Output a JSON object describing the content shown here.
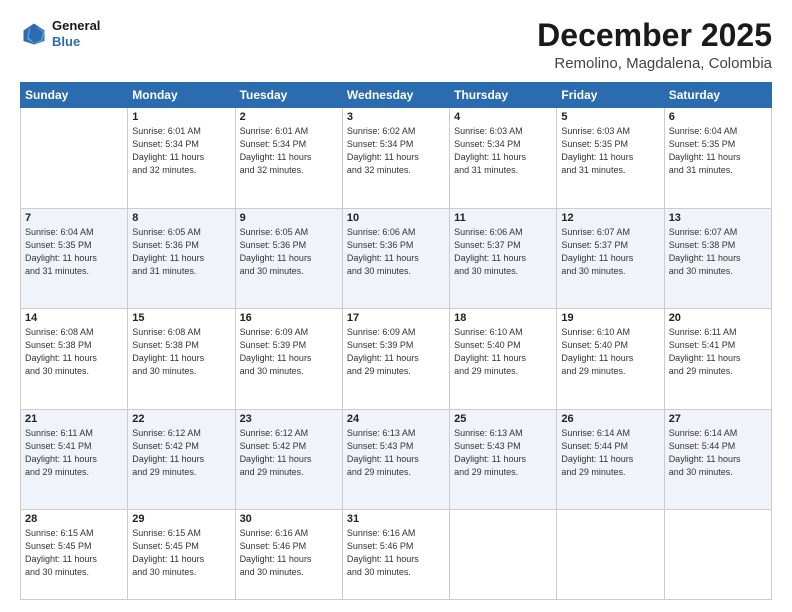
{
  "header": {
    "logo_line1": "General",
    "logo_line2": "Blue",
    "title": "December 2025",
    "subtitle": "Remolino, Magdalena, Colombia"
  },
  "days_of_week": [
    "Sunday",
    "Monday",
    "Tuesday",
    "Wednesday",
    "Thursday",
    "Friday",
    "Saturday"
  ],
  "weeks": [
    [
      {
        "day": "",
        "info": ""
      },
      {
        "day": "1",
        "info": "Sunrise: 6:01 AM\nSunset: 5:34 PM\nDaylight: 11 hours\nand 32 minutes."
      },
      {
        "day": "2",
        "info": "Sunrise: 6:01 AM\nSunset: 5:34 PM\nDaylight: 11 hours\nand 32 minutes."
      },
      {
        "day": "3",
        "info": "Sunrise: 6:02 AM\nSunset: 5:34 PM\nDaylight: 11 hours\nand 32 minutes."
      },
      {
        "day": "4",
        "info": "Sunrise: 6:03 AM\nSunset: 5:34 PM\nDaylight: 11 hours\nand 31 minutes."
      },
      {
        "day": "5",
        "info": "Sunrise: 6:03 AM\nSunset: 5:35 PM\nDaylight: 11 hours\nand 31 minutes."
      },
      {
        "day": "6",
        "info": "Sunrise: 6:04 AM\nSunset: 5:35 PM\nDaylight: 11 hours\nand 31 minutes."
      }
    ],
    [
      {
        "day": "7",
        "info": "Sunrise: 6:04 AM\nSunset: 5:35 PM\nDaylight: 11 hours\nand 31 minutes."
      },
      {
        "day": "8",
        "info": "Sunrise: 6:05 AM\nSunset: 5:36 PM\nDaylight: 11 hours\nand 31 minutes."
      },
      {
        "day": "9",
        "info": "Sunrise: 6:05 AM\nSunset: 5:36 PM\nDaylight: 11 hours\nand 30 minutes."
      },
      {
        "day": "10",
        "info": "Sunrise: 6:06 AM\nSunset: 5:36 PM\nDaylight: 11 hours\nand 30 minutes."
      },
      {
        "day": "11",
        "info": "Sunrise: 6:06 AM\nSunset: 5:37 PM\nDaylight: 11 hours\nand 30 minutes."
      },
      {
        "day": "12",
        "info": "Sunrise: 6:07 AM\nSunset: 5:37 PM\nDaylight: 11 hours\nand 30 minutes."
      },
      {
        "day": "13",
        "info": "Sunrise: 6:07 AM\nSunset: 5:38 PM\nDaylight: 11 hours\nand 30 minutes."
      }
    ],
    [
      {
        "day": "14",
        "info": "Sunrise: 6:08 AM\nSunset: 5:38 PM\nDaylight: 11 hours\nand 30 minutes."
      },
      {
        "day": "15",
        "info": "Sunrise: 6:08 AM\nSunset: 5:38 PM\nDaylight: 11 hours\nand 30 minutes."
      },
      {
        "day": "16",
        "info": "Sunrise: 6:09 AM\nSunset: 5:39 PM\nDaylight: 11 hours\nand 30 minutes."
      },
      {
        "day": "17",
        "info": "Sunrise: 6:09 AM\nSunset: 5:39 PM\nDaylight: 11 hours\nand 29 minutes."
      },
      {
        "day": "18",
        "info": "Sunrise: 6:10 AM\nSunset: 5:40 PM\nDaylight: 11 hours\nand 29 minutes."
      },
      {
        "day": "19",
        "info": "Sunrise: 6:10 AM\nSunset: 5:40 PM\nDaylight: 11 hours\nand 29 minutes."
      },
      {
        "day": "20",
        "info": "Sunrise: 6:11 AM\nSunset: 5:41 PM\nDaylight: 11 hours\nand 29 minutes."
      }
    ],
    [
      {
        "day": "21",
        "info": "Sunrise: 6:11 AM\nSunset: 5:41 PM\nDaylight: 11 hours\nand 29 minutes."
      },
      {
        "day": "22",
        "info": "Sunrise: 6:12 AM\nSunset: 5:42 PM\nDaylight: 11 hours\nand 29 minutes."
      },
      {
        "day": "23",
        "info": "Sunrise: 6:12 AM\nSunset: 5:42 PM\nDaylight: 11 hours\nand 29 minutes."
      },
      {
        "day": "24",
        "info": "Sunrise: 6:13 AM\nSunset: 5:43 PM\nDaylight: 11 hours\nand 29 minutes."
      },
      {
        "day": "25",
        "info": "Sunrise: 6:13 AM\nSunset: 5:43 PM\nDaylight: 11 hours\nand 29 minutes."
      },
      {
        "day": "26",
        "info": "Sunrise: 6:14 AM\nSunset: 5:44 PM\nDaylight: 11 hours\nand 29 minutes."
      },
      {
        "day": "27",
        "info": "Sunrise: 6:14 AM\nSunset: 5:44 PM\nDaylight: 11 hours\nand 30 minutes."
      }
    ],
    [
      {
        "day": "28",
        "info": "Sunrise: 6:15 AM\nSunset: 5:45 PM\nDaylight: 11 hours\nand 30 minutes."
      },
      {
        "day": "29",
        "info": "Sunrise: 6:15 AM\nSunset: 5:45 PM\nDaylight: 11 hours\nand 30 minutes."
      },
      {
        "day": "30",
        "info": "Sunrise: 6:16 AM\nSunset: 5:46 PM\nDaylight: 11 hours\nand 30 minutes."
      },
      {
        "day": "31",
        "info": "Sunrise: 6:16 AM\nSunset: 5:46 PM\nDaylight: 11 hours\nand 30 minutes."
      },
      {
        "day": "",
        "info": ""
      },
      {
        "day": "",
        "info": ""
      },
      {
        "day": "",
        "info": ""
      }
    ]
  ]
}
